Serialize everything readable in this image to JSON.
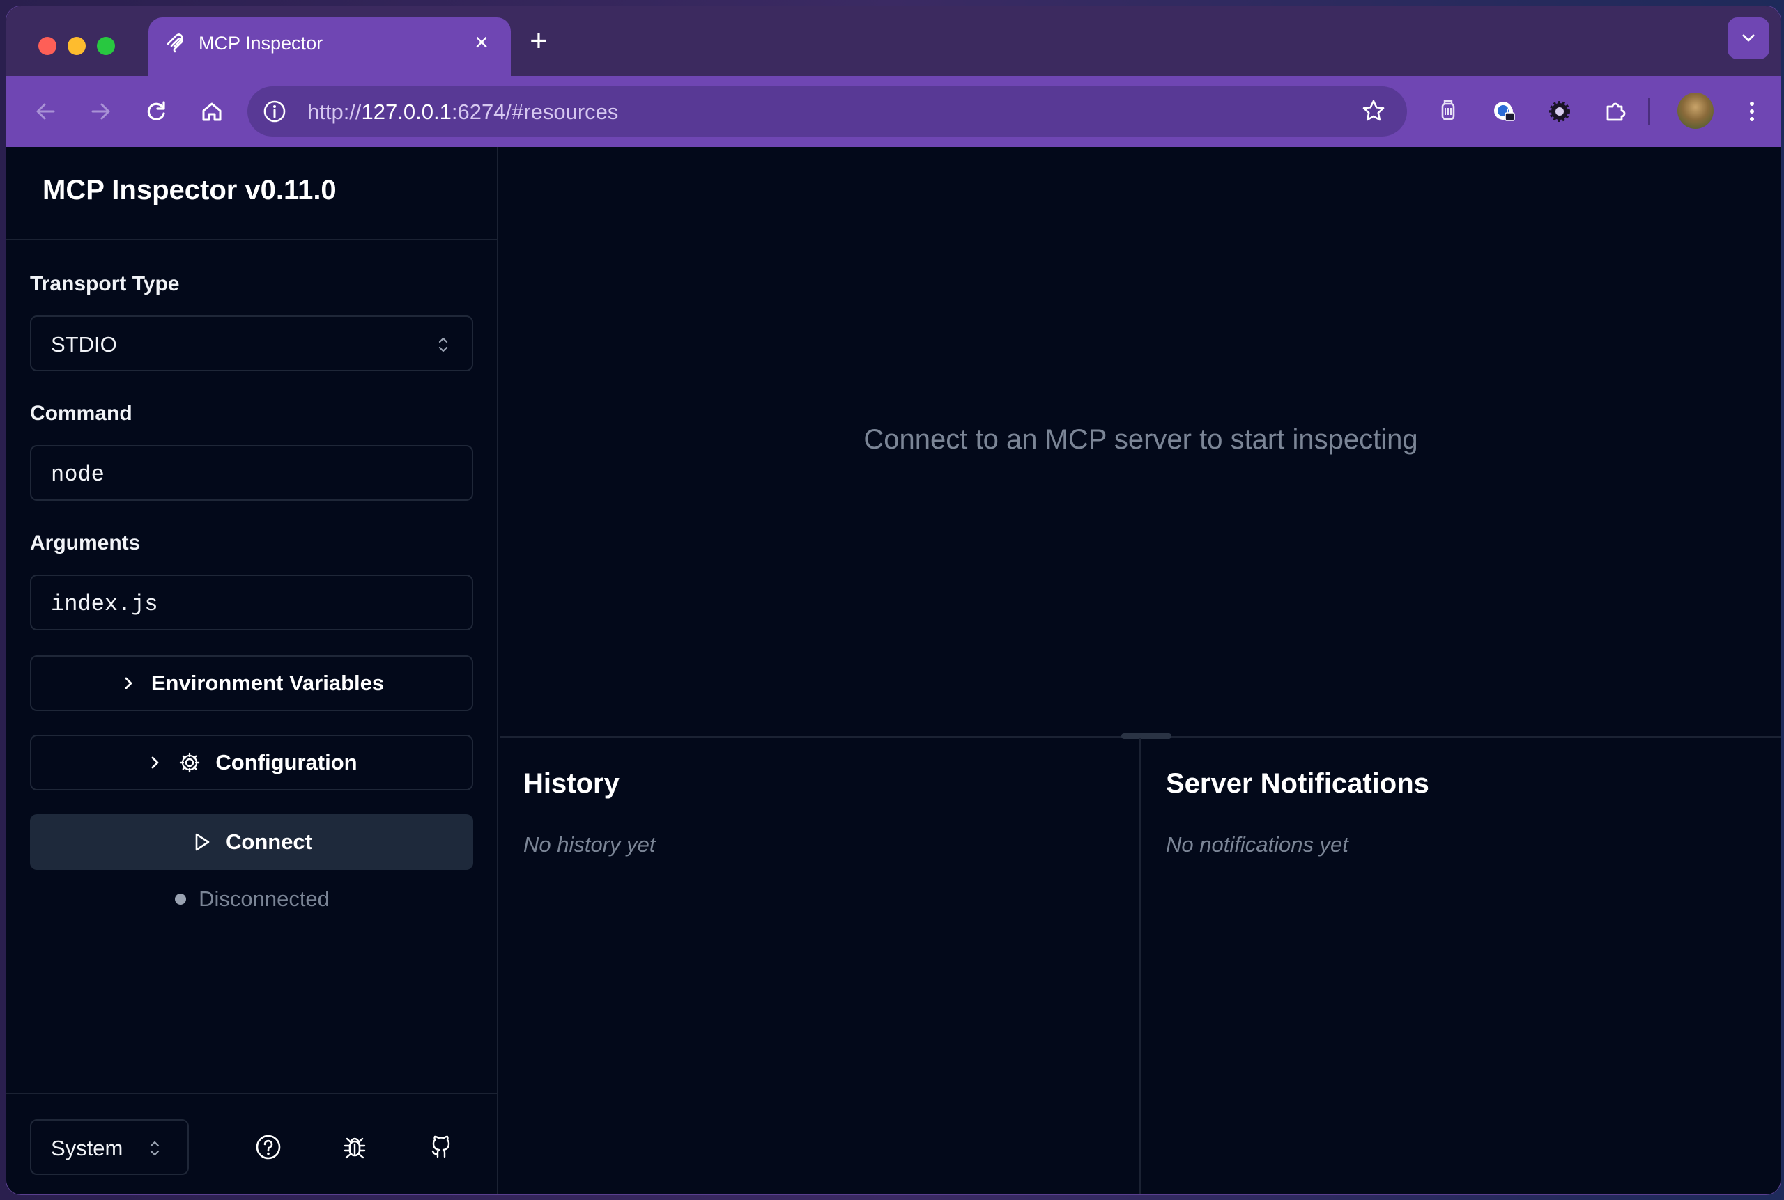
{
  "browser": {
    "tab_title": "MCP Inspector",
    "url_scheme": "http://",
    "url_host": "127.0.0.1",
    "url_rest": ":6274/#resources"
  },
  "sidebar": {
    "app_title": "MCP Inspector v0.11.0",
    "transport_label": "Transport Type",
    "transport_value": "STDIO",
    "command_label": "Command",
    "command_value": "node",
    "arguments_label": "Arguments",
    "arguments_value": "index.js",
    "env_button": "Environment Variables",
    "config_button": "Configuration",
    "connect_button": "Connect",
    "status": "Disconnected",
    "theme_value": "System"
  },
  "main": {
    "placeholder": "Connect to an MCP server to start inspecting",
    "history_title": "History",
    "history_empty": "No history yet",
    "notifications_title": "Server Notifications",
    "notifications_empty": "No notifications yet"
  },
  "colors": {
    "tab_active": "#6f46b3",
    "tabstrip": "#3c2a5f",
    "app_bg": "#03091a",
    "connect_button_bg": "#1e293b",
    "muted_text": "#7b8596"
  },
  "icons": {
    "tab": "mcp-logo-icon",
    "toolbar": [
      "back-icon",
      "forward-icon",
      "reload-icon",
      "home-icon",
      "site-info-icon",
      "bookmark-star-icon"
    ],
    "extensions": [
      "shield-extension-icon",
      "password-extension-icon",
      "settings-extension-icon",
      "puzzle-extensions-icon",
      "kebab-menu-icon"
    ],
    "sidebar": [
      "chevron-right-icon",
      "gear-icon",
      "play-icon",
      "select-caret-icon"
    ],
    "footer": [
      "help-circle-icon",
      "bug-icon",
      "github-icon"
    ]
  }
}
